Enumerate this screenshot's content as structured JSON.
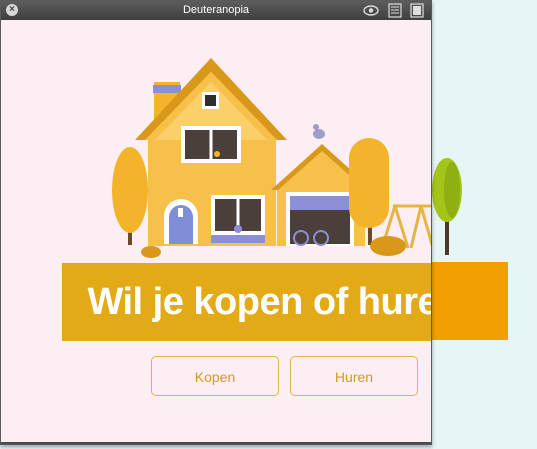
{
  "window": {
    "title": "Deuteranopia"
  },
  "icons": {
    "close": "close-icon",
    "eye": "eye-icon",
    "list": "list-icon",
    "square": "square-icon"
  },
  "banner": {
    "text": "Wil je kopen of huren?"
  },
  "buttons": {
    "buy_label": "Kopen",
    "rent_label": "Huren"
  },
  "colors": {
    "banner_bg": "#e3aa18",
    "button_text": "#d39a1d",
    "window_bg": "#fdeef3",
    "page_bg": "#e6f5f5"
  }
}
